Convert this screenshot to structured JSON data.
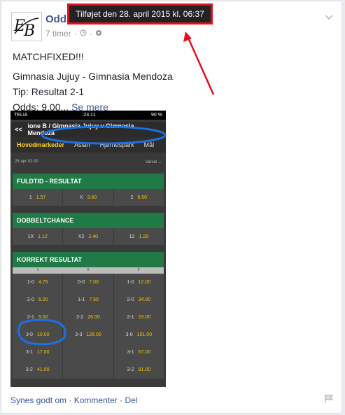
{
  "post": {
    "page_name": "Odds",
    "time": "7 timer",
    "tooltip": "Tilføjet den 28. april 2015 kl. 06:37",
    "lines": [
      "MATCHFIXED!!!",
      "Gimnasia Jujuy - Gimnasia Mendoza",
      "Tip: Resultat 2-1"
    ],
    "odds_line": "Odds: 9.00...",
    "see_more": "Se mere"
  },
  "phone": {
    "carrier": "TELIA",
    "clock": "23.11",
    "battery": "90 %",
    "nav_title": "ione B / Gimnasia Jujuy v Gimnasia Mendoza",
    "tabs": [
      "Hovedmarkeder",
      "Asian",
      "Hjørnespark",
      "Mål"
    ],
    "date": "28 apr 02:00",
    "dropdown": "Varsel",
    "fuldtid": {
      "title": "FULDTID - RESULTAT",
      "cells": [
        [
          "1",
          "1.57"
        ],
        [
          "X",
          "3.60"
        ],
        [
          "2",
          "6.50"
        ]
      ]
    },
    "dobbelt": {
      "title": "DOBBELTCHANCE",
      "cells": [
        [
          "1X",
          "1.12"
        ],
        [
          "X2",
          "2.40"
        ],
        [
          "12",
          "1.29"
        ]
      ]
    },
    "korrekt": {
      "title": "KORREKT RESULTAT",
      "cols": [
        "1",
        "X",
        "2"
      ],
      "rows": [
        [
          [
            "1-0",
            "4.75"
          ],
          [
            "0-0",
            "7.00"
          ],
          [
            "1-0",
            "12.00"
          ]
        ],
        [
          [
            "2-0",
            "6.00"
          ],
          [
            "1-1",
            "7.50"
          ],
          [
            "2-0",
            "34.00"
          ]
        ],
        [
          [
            "2-1",
            "9.00"
          ],
          [
            "2-2",
            "26.00"
          ],
          [
            "2-1",
            "23.00"
          ]
        ],
        [
          [
            "3-0",
            "10.00"
          ],
          [
            "3-3",
            "126.00"
          ],
          [
            "3-0",
            "101.00"
          ]
        ],
        [
          [
            "3-1",
            "17.00"
          ],
          [
            "",
            ""
          ],
          [
            "3-1",
            "67.00"
          ]
        ],
        [
          [
            "3-2",
            "41.00"
          ],
          [
            "",
            ""
          ],
          [
            "3-2",
            "81.00"
          ]
        ]
      ]
    }
  },
  "footer": {
    "like": "Synes godt om",
    "comment": "Kommenter",
    "share": "Del",
    "sep": "·"
  },
  "colors": {
    "link": "#365899",
    "annotation_red": "#e2101a",
    "annotation_blue": "#1e6fe0",
    "market_green": "#1f7a45",
    "odds_yellow": "#f5c400"
  }
}
